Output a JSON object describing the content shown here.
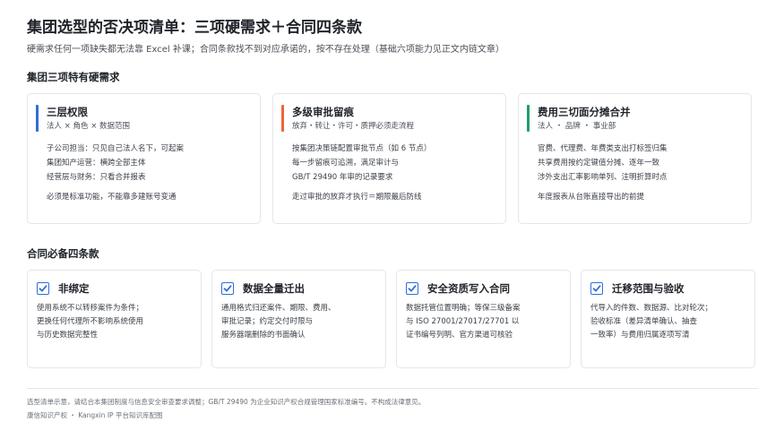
{
  "header": {
    "title": "集团选型的否决项清单：三项硬需求＋合同四条款",
    "subtitle": "硬需求任何一项缺失都无法靠 Excel 补课；合同条款找不到对应承诺的，按不存在处理（基础六项能力见正文内链文章）"
  },
  "section1": {
    "title": "集团三项特有硬需求",
    "cards": [
      {
        "title": "三层权限",
        "tag": "法人 × 角色 × 数据范围",
        "accent": "#2f6fd6",
        "lines": [
          "子公司担当：只见自己法人名下，可起案",
          "集团知产运营：横跨全部主体",
          "经营层与财务：只看合并报表"
        ],
        "note": "必须是标准功能，不能靠多建账号变通"
      },
      {
        "title": "多级审批留痕",
        "tag": "放弃・转让・许可・质押必须走流程",
        "accent": "#e8663d",
        "lines": [
          "按集团决策链配置审批节点（如 6 节点）",
          "每一步留痕可追溯，满足审计与",
          "GB/T 29490 年审的记录要求"
        ],
        "note": "走过审批的放弃才执行＝期限最后防线"
      },
      {
        "title": "费用三切面分摊合并",
        "tag": "法人 ・ 品牌 ・ 事业部",
        "accent": "#1f9d6b",
        "lines": [
          "官费、代理费、年费类支出打标签归集",
          "共享费用按约定键值分摊、逐年一致",
          "涉外支出汇率影响单列、注明折算时点"
        ],
        "note": "年度报表从台账直接导出的前提"
      }
    ]
  },
  "section2": {
    "title": "合同必备四条款",
    "cards": [
      {
        "title": "非绑定",
        "lines": [
          "使用系统不以转移案件为条件；",
          "更换任何代理所不影响系统使用",
          "与历史数据完整性"
        ]
      },
      {
        "title": "数据全量迁出",
        "lines": [
          "通用格式归还案件、期限、费用、",
          "审批记录；约定交付时限与",
          "服务器端删除的书面确认"
        ]
      },
      {
        "title": "安全资质写入合同",
        "lines": [
          "数据托管位置明确；等保三级备案",
          "与 ISO 27001/27017/27701 以",
          "证书编号列明、官方渠道可核验"
        ]
      },
      {
        "title": "迁移范围与验收",
        "lines": [
          "代导入的件数、数据源、比对轮次；",
          "验收标准（差异清单确认、抽查",
          "一致率）与费用归属逐项写清"
        ]
      }
    ]
  },
  "footer": {
    "note": "选型清单示意，请结合本集团制度与信息安全审查要求调整；GB/T 29490 为企业知识产权合规管理国家标准编号。不构成法律意见。",
    "credit": "康信知识产权 ・ Kangxin IP 平台知识库配图"
  },
  "colors": {
    "check": "#2f6fd6"
  }
}
